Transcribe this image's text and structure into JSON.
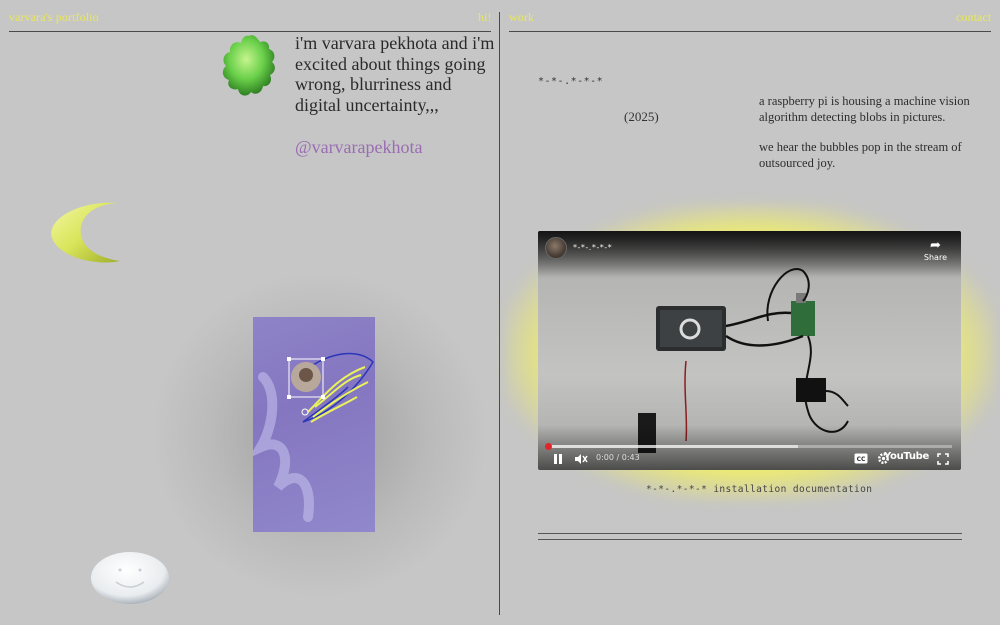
{
  "header": {
    "left_title": "varvara's portfolio",
    "hi_link": "hi!",
    "work_link": "work",
    "contact_link": "contact"
  },
  "intro": {
    "text": "i'm varvara pekhota and i'm excited about things going wrong, blurriness and digital uncertainty,,,",
    "handle": "@varvarapekhota"
  },
  "project": {
    "title": "*-*-.*-*-*",
    "year": "(2025)",
    "description_1": "a raspberry pi is housing a machine vision algorithm detecting blobs in pictures.",
    "description_2": "we hear the bubbles pop in the stream of outsourced joy.",
    "caption": "*-*-.*-*-* installation documentation"
  },
  "video": {
    "title": "*-*-.*-*-*",
    "share_label": "Share",
    "time": "0:00 / 0:43",
    "brand": "YouTube",
    "played_fraction": 0.0,
    "buffered_fraction": 0.62
  },
  "icons": {
    "flower": "flower-3d-icon",
    "moon": "crescent-3d-icon",
    "smiley": "smiley-3d-icon"
  },
  "colors": {
    "accent_yellow": "#e9e85a",
    "handle_purple": "#9a6db3",
    "background": "#c6c6c6",
    "glow": "#f1ef68"
  }
}
